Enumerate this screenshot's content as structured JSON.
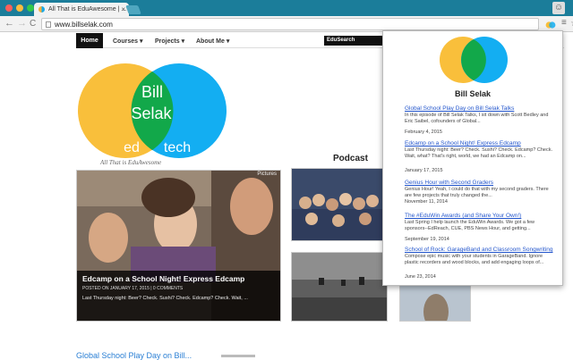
{
  "browser": {
    "tab_title": "All That is EduAwesome | ...",
    "tab_close": "×",
    "url": "www.billselak.com",
    "back": "←",
    "forward": "→",
    "reload": "C",
    "star": "☆",
    "menu": "≡",
    "profile": "☺"
  },
  "site": {
    "nav": {
      "home": "Home",
      "courses": "Courses",
      "projects": "Projects",
      "about": "About Me",
      "search": "EduSearch"
    },
    "logo": {
      "line1": "Bill",
      "line2": "Selak",
      "left": "ed",
      "right": "tech",
      "tagline": "All That is EduAwesome"
    },
    "podcast_title": "Podcast",
    "featured": {
      "label": "Pictures",
      "title": "Edcamp on a School Night! Express Edcamp",
      "meta": "POSTED ON JANUARY 17, 2015 | 0 COMMENTS",
      "excerpt": "Last Thursday night: Beer? Check. Sushi? Check. Edcamp? Check. Wait, ..."
    },
    "bottom_link": "Global School Play Day on Bill..."
  },
  "popup": {
    "name": "Bill Selak",
    "posts": [
      {
        "title": "Global School Play Day on Bill Selak Talks",
        "excerpt": "In this episode of Bill Selak Talks, I sit down with Scott Bedley and Eric Saibel, cofounders of Global...",
        "date": "February 4, 2015"
      },
      {
        "title": "Edcamp on a School Night! Express Edcamp",
        "excerpt": "Last Thursday night: Beer? Check. Sushi? Check. Edcamp? Check. Wait, what? That's right, world, we had an Edcamp on...",
        "date": "January 17, 2015"
      },
      {
        "title": "Genius Hour with Second Graders",
        "excerpt": "Genius Hour! Yeah, I could do that with my second graders. There are few projects that truly changed the...",
        "date": "November 11, 2014"
      },
      {
        "title": "The #EduWin Awards (and Share Your Own!)",
        "excerpt": "Last Spring I help launch the EduWin Awards. We got a few sponsors--EdReach, CUE, PBS News Hour, and getting...",
        "date": "September 19, 2014"
      },
      {
        "title": "School of Rock: GarageBand and Classroom Songwriting",
        "excerpt": "Compose epic music with your students in GarageBand. Ignore plastic recorders and wood blocks, and add engaging loops of...",
        "date": "June 23, 2014"
      }
    ]
  },
  "colors": {
    "chrome_blue": "#1b7d9a",
    "venn_yellow": "#f9bf3b",
    "venn_blue": "#13aef2",
    "venn_green": "#12a84a"
  }
}
